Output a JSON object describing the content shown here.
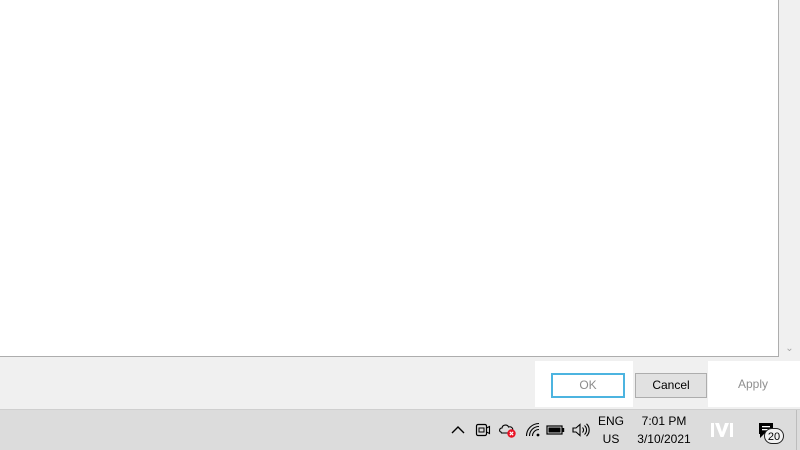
{
  "dialog": {
    "buttons": {
      "ok_label": "OK",
      "cancel_label": "Cancel",
      "apply_label": "Apply"
    }
  },
  "scrollbar": {
    "down_arrow": "⌄"
  },
  "taskbar": {
    "tray_icons": [
      "chevron-up-icon",
      "meet-now-icon",
      "onedrive-error-icon",
      "wifi-icon",
      "battery-icon",
      "volume-icon"
    ],
    "language": {
      "line1": "ENG",
      "line2": "US"
    },
    "clock": {
      "time": "7:01 PM",
      "date": "3/10/2021"
    },
    "app_icon": "mw-logo-icon",
    "notifications": {
      "count": "20"
    }
  },
  "colors": {
    "focus_border": "#4cb4e0",
    "error_badge": "#e81123",
    "taskbar_bg": "#dcdcdc"
  }
}
